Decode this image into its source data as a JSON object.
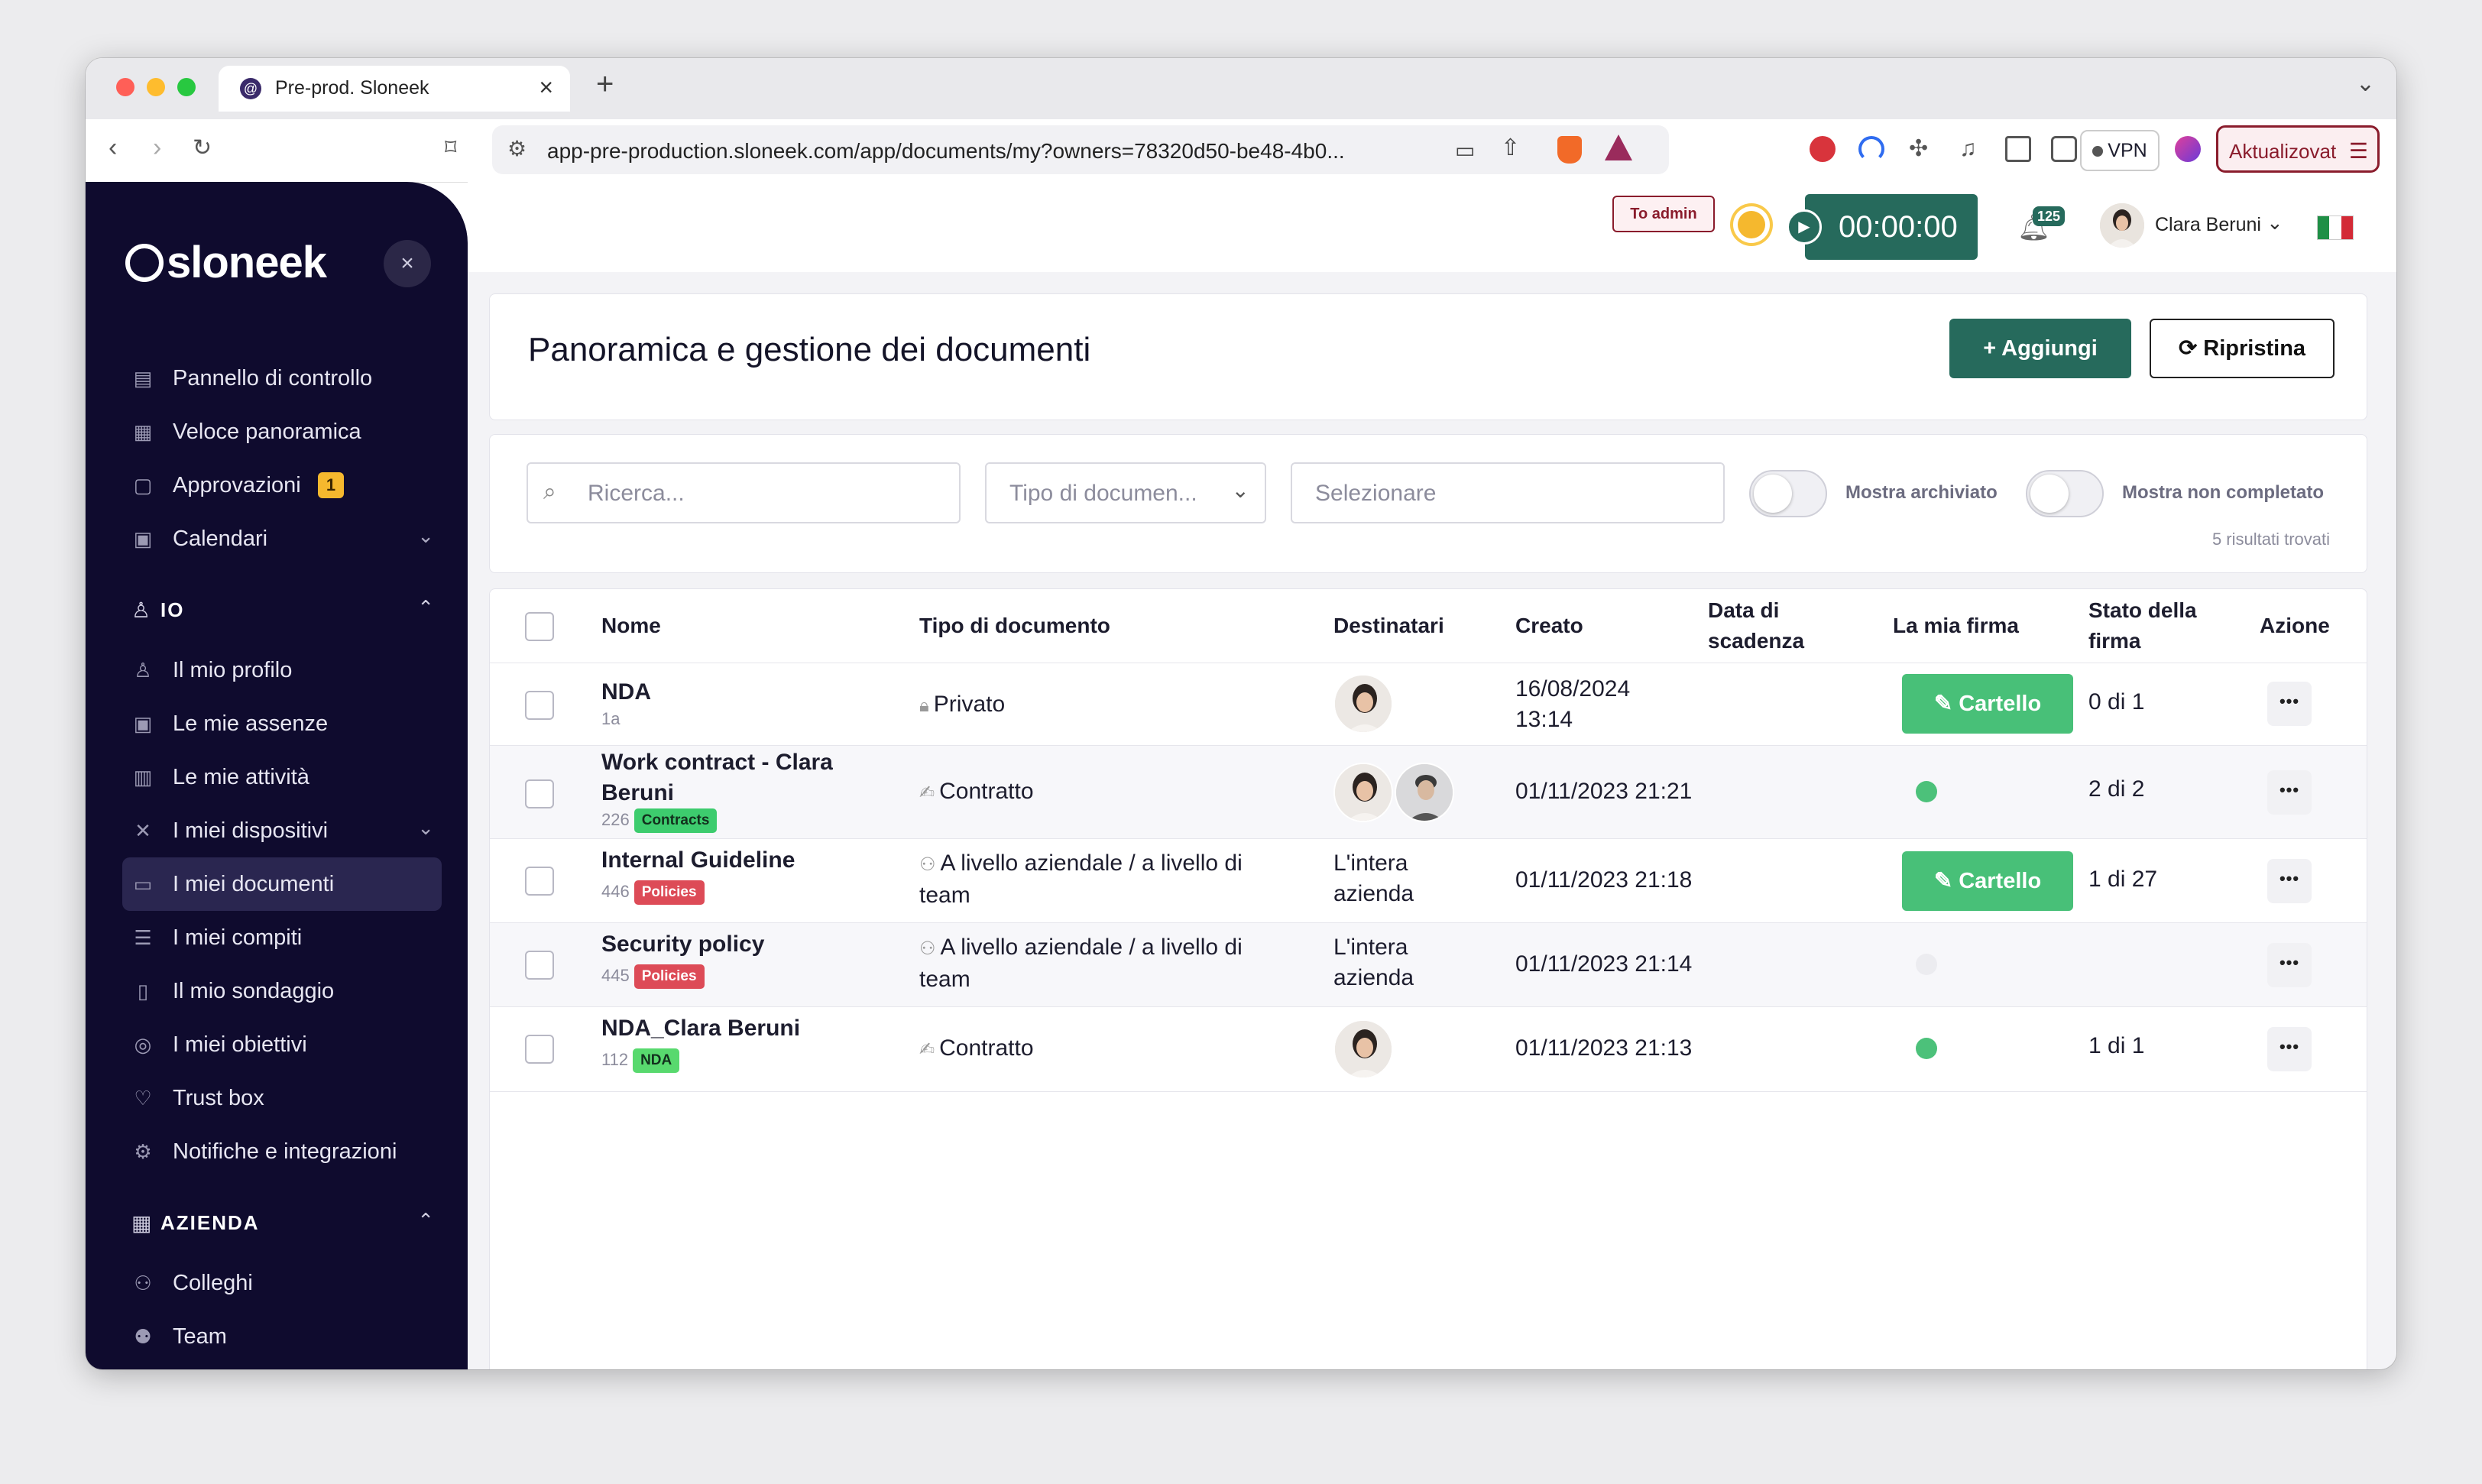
{
  "browser": {
    "tab_title": "Pre-prod. Sloneek",
    "url": "app-pre-production.sloneek.com/app/documents/my?owners=78320d50-be48-4b0...",
    "vpn_label": "VPN",
    "update_label": "Aktualizovat",
    "traffic_colors": [
      "#ff5f57",
      "#febc2e",
      "#28c840"
    ]
  },
  "sidebar": {
    "logo_text": "sloneek",
    "items_top": [
      {
        "label": "Pannello di controllo",
        "icon": "dashboard-icon"
      },
      {
        "label": "Veloce panoramica",
        "icon": "grid-icon"
      },
      {
        "label": "Approvazioni",
        "icon": "clipboard-icon",
        "badge": "1"
      },
      {
        "label": "Calendari",
        "icon": "calendar-icon",
        "has_chevron": true
      }
    ],
    "section_io": {
      "label": "IO"
    },
    "items_io": [
      {
        "label": "Il mio profilo",
        "icon": "user-icon"
      },
      {
        "label": "Le mie assenze",
        "icon": "absence-calendar-icon"
      },
      {
        "label": "Le mie attività",
        "icon": "book-icon"
      },
      {
        "label": "I miei dispositivi",
        "icon": "tools-icon",
        "has_chevron": true
      },
      {
        "label": "I miei documenti",
        "icon": "folder-icon",
        "active": true
      },
      {
        "label": "I miei compiti",
        "icon": "checklist-icon"
      },
      {
        "label": "Il mio sondaggio",
        "icon": "poll-icon"
      },
      {
        "label": "I miei obiettivi",
        "icon": "target-icon"
      },
      {
        "label": "Trust box",
        "icon": "trust-hand-icon"
      },
      {
        "label": "Notifiche e integrazioni",
        "icon": "gear-icon"
      }
    ],
    "section_azienda": {
      "label": "AZIENDA"
    },
    "items_azienda": [
      {
        "label": "Colleghi",
        "icon": "colleagues-icon"
      },
      {
        "label": "Team",
        "icon": "team-icon"
      }
    ]
  },
  "header": {
    "to_admin_label": "To admin",
    "timer": "00:00:00",
    "notif_count": "125",
    "user_name": "Clara Beruni"
  },
  "page": {
    "title": "Panoramica e gestione dei documenti",
    "add_label": "Aggiungi",
    "reset_label": "Ripristina"
  },
  "filters": {
    "search_placeholder": "Ricerca...",
    "doc_type_placeholder": "Tipo di documen...",
    "select_placeholder": "Selezionare",
    "show_archived_label": "Mostra archiviato",
    "show_incomplete_label": "Mostra non completato",
    "results_text": "5 risultati trovati"
  },
  "table": {
    "headers": {
      "name": "Nome",
      "doc_type": "Tipo di documento",
      "recipients": "Destinatari",
      "created": "Creato",
      "due_l1": "Data di",
      "due_l2": "scadenza",
      "my_signature": "La mia firma",
      "sig_state_l1": "Stato della",
      "sig_state_l2": "firma",
      "action": "Azione"
    },
    "rows": [
      {
        "name": "NDA",
        "sub": "1a",
        "type_icon": "lock-icon",
        "type": "Privato",
        "recipients_text": "",
        "created": "16/08/2024 13:14",
        "signature_label": "Cartello",
        "state": "0 di 1"
      },
      {
        "name": "Work contract - Clara Beruni",
        "sub": "226",
        "tag": "Contracts",
        "type_icon": "signature-icon",
        "type": "Contratto",
        "recipients_text": "",
        "created": "01/11/2023 21:21",
        "signature_dot": "#4cc17a",
        "state": "2 di 2"
      },
      {
        "name": "Internal Guideline",
        "sub": "446",
        "tag": "Policies",
        "type_icon": "people-icon",
        "type": "A livello aziendale / a livello di team",
        "recipients_text": "L'intera azienda",
        "created": "01/11/2023 21:18",
        "signature_label": "Cartello",
        "state": "1 di 27"
      },
      {
        "name": "Security policy",
        "sub": "445",
        "tag": "Policies",
        "type_icon": "people-icon",
        "type": "A livello aziendale / a livello di team",
        "recipients_text": "L'intera azienda",
        "created": "01/11/2023 21:14",
        "signature_dot": "#ececf0",
        "state": ""
      },
      {
        "name": "NDA_Clara Beruni",
        "sub": "112",
        "tag": "NDA",
        "type_icon": "signature-icon",
        "type": "Contratto",
        "recipients_text": "",
        "created": "01/11/2023 21:13",
        "signature_dot": "#4cc17a",
        "state": "1 di 1"
      }
    ],
    "action_label": "•••"
  },
  "colors": {
    "sidebar_bg": "#0f0b2e",
    "primary": "#266a5c",
    "sign_button": "#48c078",
    "policy_tag": "#dd4b57",
    "contract_tag": "#3dcc6e"
  }
}
